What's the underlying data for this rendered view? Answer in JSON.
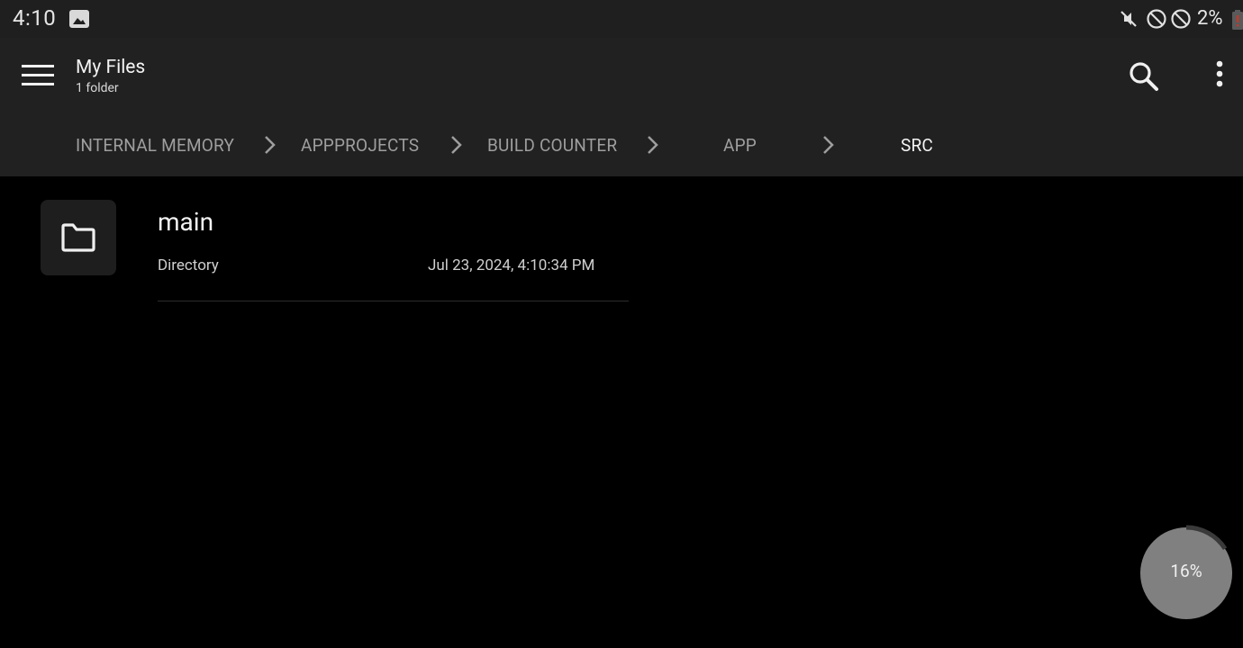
{
  "status_bar": {
    "time": "4:10",
    "battery_percent": "2%",
    "icons": [
      "gallery-icon",
      "mute-icon",
      "do-not-disturb-icon",
      "do-not-disturb-icon",
      "battery-low-icon"
    ]
  },
  "app_bar": {
    "title": "My Files",
    "subtitle": "1 folder",
    "icons": [
      "menu-icon",
      "search-icon",
      "more-vert-icon"
    ]
  },
  "breadcrumb": {
    "items": [
      {
        "label": "INTERNAL MEMORY",
        "active": false
      },
      {
        "label": "APPPROJECTS",
        "active": false
      },
      {
        "label": "BUILD COUNTER",
        "active": false
      },
      {
        "label": "APP",
        "active": false
      },
      {
        "label": "SRC",
        "active": true
      }
    ]
  },
  "files": [
    {
      "name": "main",
      "type": "Directory",
      "modified": "Jul 23, 2024, 4:10:34 PM",
      "icon": "folder-icon"
    }
  ],
  "progress": {
    "label": "16%",
    "value": 0.16
  },
  "colors": {
    "status_bar_bg": "#1f1f1f",
    "app_bar_bg": "#212121",
    "content_bg": "#000000",
    "crumb_inactive": "#9e9e9e",
    "crumb_active": "#f5f5f5",
    "battery_warning": "#c0392b",
    "progress_fill": "#808080"
  }
}
